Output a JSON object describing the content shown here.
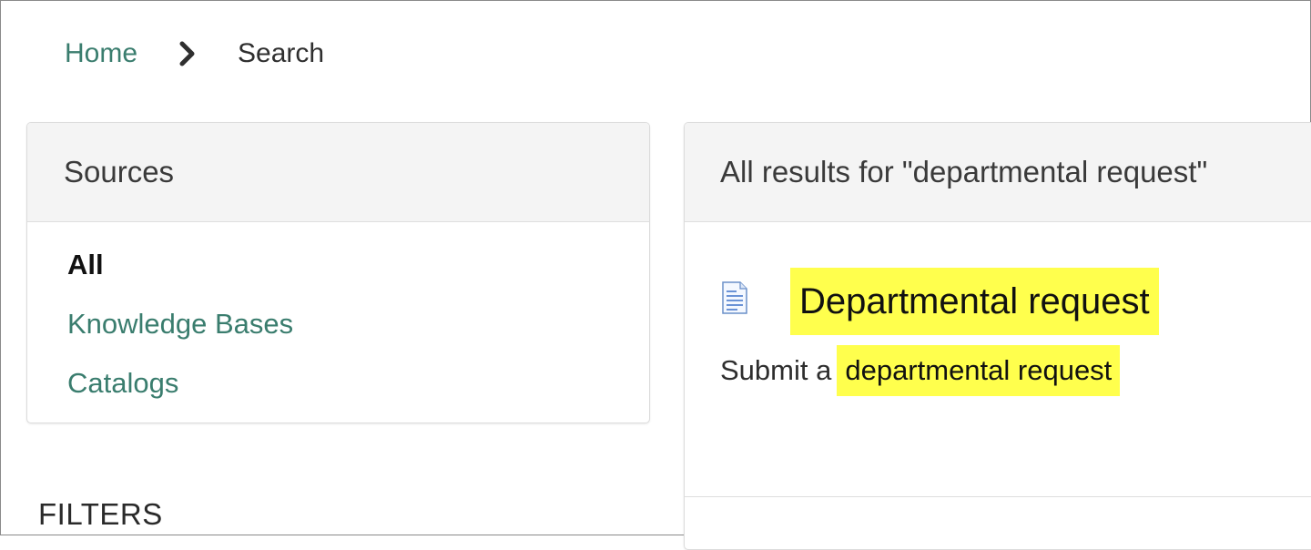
{
  "breadcrumb": {
    "home": "Home",
    "current": "Search",
    "separator_icon": "chevron-right-icon"
  },
  "sources": {
    "title": "Sources",
    "items": [
      {
        "label": "All",
        "active": true
      },
      {
        "label": "Knowledge Bases",
        "active": false
      },
      {
        "label": "Catalogs",
        "active": false
      }
    ]
  },
  "results": {
    "header": "All results for \"departmental request\"",
    "items": [
      {
        "icon": "document-icon",
        "title": "Departmental request",
        "snippet_prefix": "Submit a",
        "snippet_highlight": "departmental request"
      }
    ]
  },
  "filters": {
    "heading": "FILTERS"
  },
  "colors": {
    "link": "#3a7d6e",
    "highlight": "#ffff4d",
    "header_bg": "#f4f4f4",
    "text": "#2e2e2e"
  }
}
